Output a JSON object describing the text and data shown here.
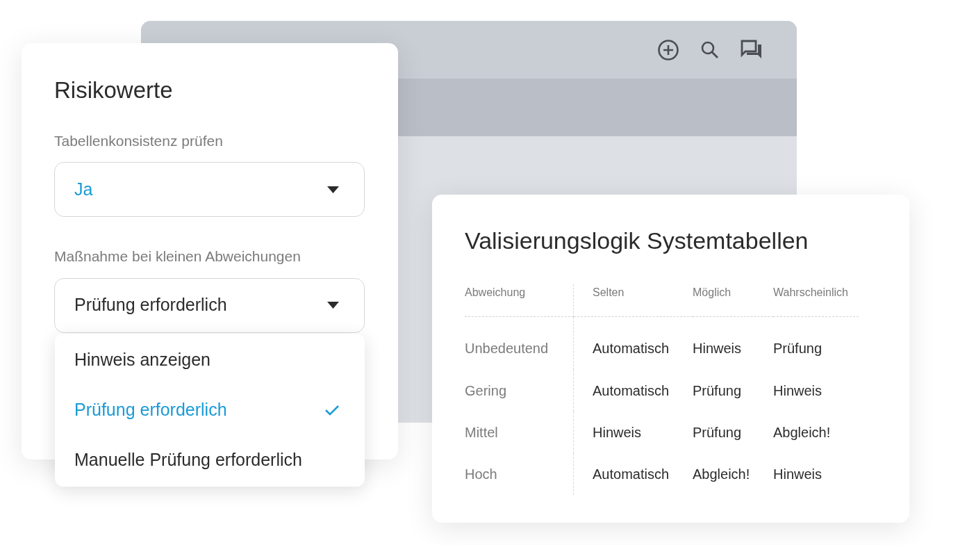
{
  "settings_panel": {
    "title": "Risikowerte",
    "fields": [
      {
        "label": "Tabellenkonsistenz prüfen",
        "value": "Ja",
        "color": "#1a9bd7"
      },
      {
        "label": "Maßnahme bei kleinen Abweichungen",
        "value": "Prüfung erforderlich",
        "color": "#2b2b2b",
        "options": [
          {
            "label": "Hinweis anzeigen",
            "selected": false
          },
          {
            "label": "Prüfung erforderlich",
            "selected": true
          },
          {
            "label": "Manuelle Prüfung erforderlich",
            "selected": false
          }
        ]
      }
    ]
  },
  "validation_panel": {
    "title": "Valisierungslogik Systemtabellen",
    "table": {
      "columns": [
        "Abweichung",
        "Selten",
        "Möglich",
        "Wahrscheinlich"
      ],
      "rows": [
        [
          "Unbedeutend",
          "Automatisch",
          "Hinweis",
          "Prüfung"
        ],
        [
          "Gering",
          "Automatisch",
          "Prüfung",
          "Hinweis"
        ],
        [
          "Mittel",
          "Hinweis",
          "Prüfung",
          "Abgleich!"
        ],
        [
          "Hoch",
          "Automatisch",
          "Abgleich!",
          "Hinweis"
        ]
      ]
    }
  }
}
